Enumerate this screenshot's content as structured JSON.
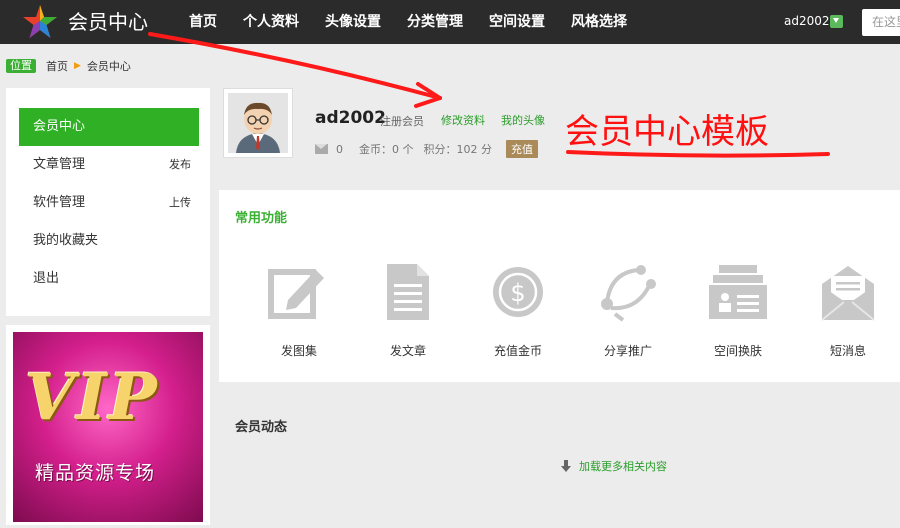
{
  "header": {
    "brand": "会员中心",
    "nav": [
      "首页",
      "个人资料",
      "头像设置",
      "分类管理",
      "空间设置",
      "风格选择"
    ],
    "username": "ad2002",
    "search_placeholder": "在这里"
  },
  "breadcrumb": {
    "tag": "位置",
    "home": "首页",
    "current": "会员中心"
  },
  "sidebar": {
    "items": [
      {
        "label": "会员中心",
        "extra": ""
      },
      {
        "label": "文章管理",
        "extra": "发布"
      },
      {
        "label": "软件管理",
        "extra": "上传"
      },
      {
        "label": "我的收藏夹",
        "extra": ""
      },
      {
        "label": "退出",
        "extra": ""
      }
    ]
  },
  "banner": {
    "title": "VIP",
    "subtitle": "精品资源专场"
  },
  "profile": {
    "username": "ad2002",
    "role": "注册会员",
    "edit_link": "修改资料",
    "avatar_link": "我的头像",
    "messages": "0",
    "coins": "金币：0 个",
    "points": "积分：102 分",
    "recharge": "充值"
  },
  "annotation": "会员中心模板",
  "functions": {
    "title": "常用功能",
    "items": [
      {
        "label": "发图集",
        "icon": "edit-icon"
      },
      {
        "label": "发文章",
        "icon": "document-icon"
      },
      {
        "label": "充值金币",
        "icon": "dollar-icon"
      },
      {
        "label": "分享推广",
        "icon": "share-icon"
      },
      {
        "label": "空间换肤",
        "icon": "skin-icon"
      },
      {
        "label": "短消息",
        "icon": "envelope-icon"
      }
    ]
  },
  "activity": {
    "title": "会员动态",
    "more": "加载更多相关内容"
  },
  "colors": {
    "accent": "#2fb025",
    "annotation": "#ff1111",
    "topbar": "#2b2b2b"
  }
}
